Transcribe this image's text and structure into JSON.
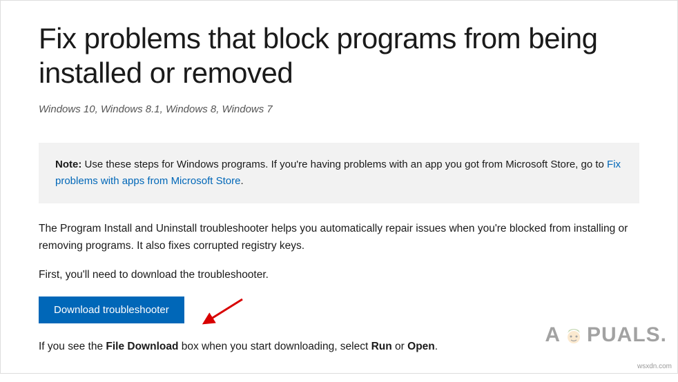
{
  "title": "Fix problems that block programs from being installed or removed",
  "applies_to": "Windows 10, Windows 8.1, Windows 8, Windows 7",
  "note": {
    "label": "Note:",
    "text_before_link": " Use these steps for Windows programs. If you're having problems with an app you got from Microsoft Store, go to ",
    "link_text": "Fix problems with apps from Microsoft Store",
    "text_after_link": "."
  },
  "paragraph1": "The Program Install and Uninstall troubleshooter helps you automatically repair issues when you're blocked from installing or removing programs. It also fixes corrupted registry keys.",
  "paragraph2": "First, you'll need to download the troubleshooter.",
  "download_button": "Download troubleshooter",
  "paragraph3": {
    "before1": "If you see the ",
    "bold1": "File Download",
    "mid": " box when you start downloading, select ",
    "bold2": "Run",
    "mid2": " or ",
    "bold3": "Open",
    "after": "."
  },
  "watermark": {
    "letter_a": "A",
    "letters_rest": "PUALS."
  },
  "footer": "wsxdn.com"
}
